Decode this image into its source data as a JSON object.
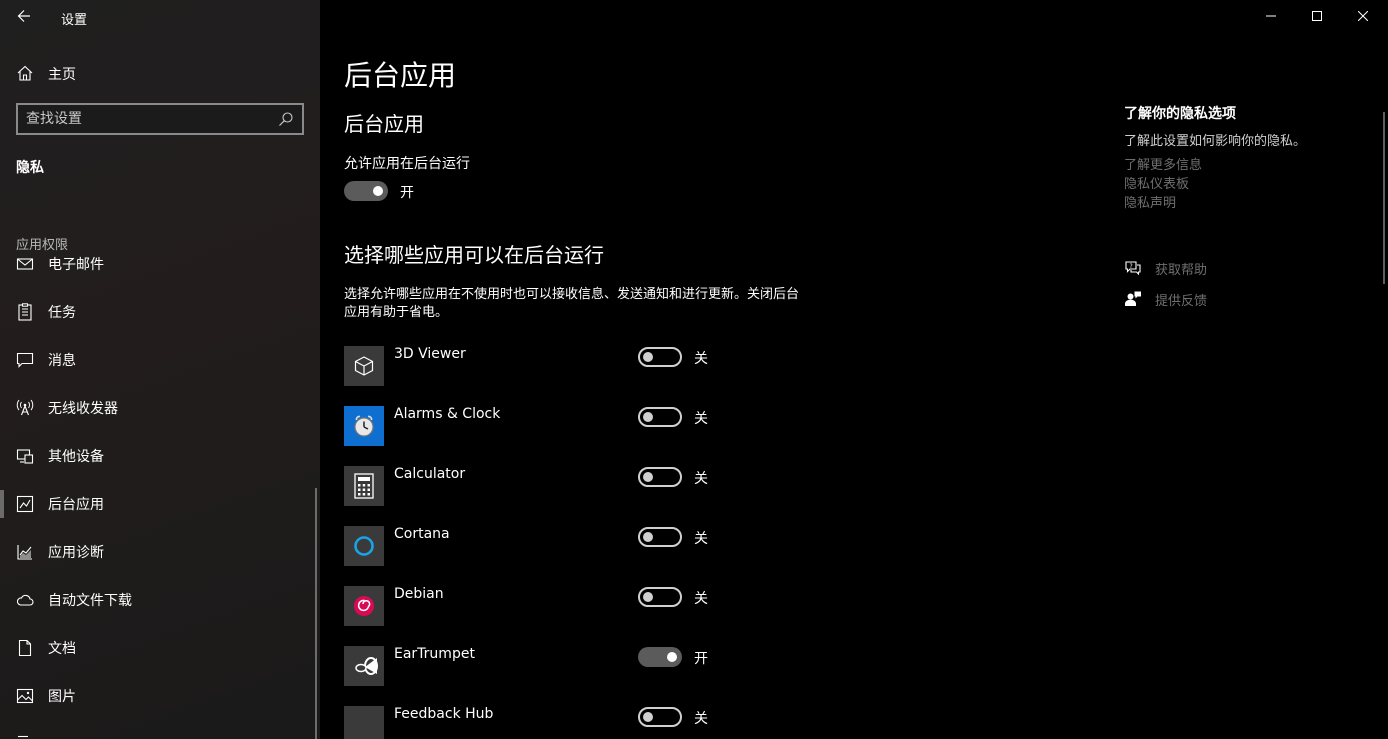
{
  "window": {
    "title": "设置"
  },
  "sidebar": {
    "home_label": "主页",
    "search_placeholder": "查找设置",
    "section_title": "隐私",
    "group_label": "应用权限",
    "items": [
      {
        "label": "电子邮件",
        "icon": "mail-icon"
      },
      {
        "label": "任务",
        "icon": "tasks-icon"
      },
      {
        "label": "消息",
        "icon": "message-icon"
      },
      {
        "label": "无线收发器",
        "icon": "radio-antenna-icon"
      },
      {
        "label": "其他设备",
        "icon": "other-devices-icon"
      },
      {
        "label": "后台应用",
        "icon": "background-apps-icon",
        "active": true
      },
      {
        "label": "应用诊断",
        "icon": "app-diagnostics-icon"
      },
      {
        "label": "自动文件下载",
        "icon": "cloud-icon"
      },
      {
        "label": "文档",
        "icon": "document-icon"
      },
      {
        "label": "图片",
        "icon": "picture-icon"
      }
    ]
  },
  "main": {
    "page_title": "后台应用",
    "sub_title": "后台应用",
    "allow_label": "允许应用在后台运行",
    "allow_toggle": {
      "on": true,
      "state_text": "开"
    },
    "choose_title": "选择哪些应用可以在后台运行",
    "description": "选择允许哪些应用在不使用时也可以接收信息、发送通知和进行更新。关闭后台应用有助于省电。",
    "apps": [
      {
        "name": "3D Viewer",
        "on": false,
        "state_text": "关",
        "icon": "cube-icon",
        "icon_bg": "#3a3a3a"
      },
      {
        "name": "Alarms & Clock",
        "on": false,
        "state_text": "关",
        "icon": "clock-icon",
        "icon_bg": "#0f6fd1"
      },
      {
        "name": "Calculator",
        "on": false,
        "state_text": "关",
        "icon": "calculator-icon",
        "icon_bg": "#3a3a3a"
      },
      {
        "name": "Cortana",
        "on": false,
        "state_text": "关",
        "icon": "cortana-icon",
        "icon_bg": "#3a3a3a"
      },
      {
        "name": "Debian",
        "on": false,
        "state_text": "关",
        "icon": "debian-icon",
        "icon_bg": "#3a3a3a"
      },
      {
        "name": "EarTrumpet",
        "on": true,
        "state_text": "开",
        "icon": "eartrumpet-icon",
        "icon_bg": "#3a3a3a"
      },
      {
        "name": "Feedback Hub",
        "on": false,
        "state_text": "关",
        "icon": "feedback-hub-icon",
        "icon_bg": "#3a3a3a"
      }
    ]
  },
  "right_pane": {
    "title": "了解你的隐私选项",
    "description": "了解此设置如何影响你的隐私。",
    "links": [
      "了解更多信息",
      "隐私仪表板",
      "隐私声明"
    ],
    "actions": [
      {
        "label": "获取帮助",
        "icon": "get-help-icon"
      },
      {
        "label": "提供反馈",
        "icon": "give-feedback-icon"
      }
    ]
  },
  "colors": {
    "accent_blue": "#0f6fd1",
    "cortana_ring": "#1aa3e8",
    "debian_red": "#d70a53",
    "link_gray": "#6f6f6f"
  }
}
